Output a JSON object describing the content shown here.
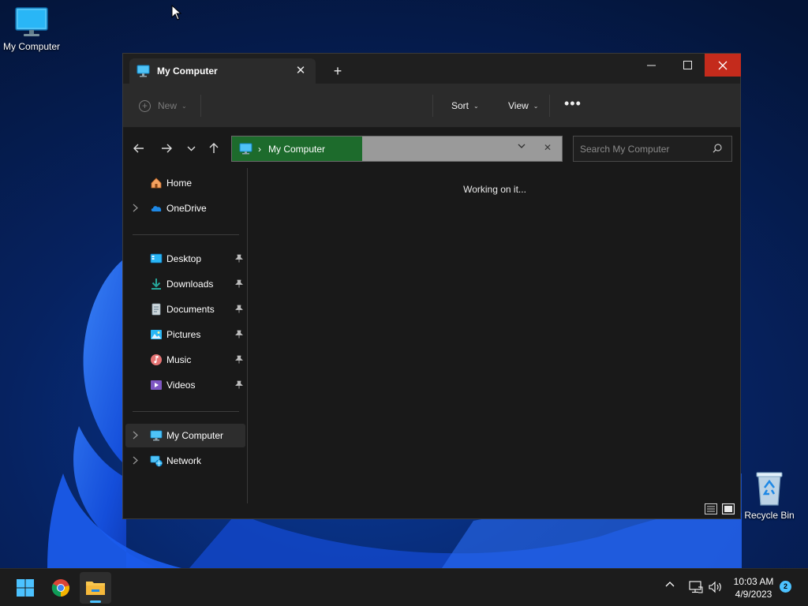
{
  "desktop": {
    "icons": [
      {
        "label": "My Computer",
        "icon": "monitor-icon"
      },
      {
        "label": "Recycle Bin",
        "icon": "recycle-bin-icon"
      }
    ]
  },
  "window": {
    "tab_title": "My Computer",
    "tab_icon": "monitor-icon",
    "controls": {
      "minimize": "minimize-icon",
      "maximize": "maximize-icon",
      "close": "close-icon"
    },
    "close_color": "#c42b1c"
  },
  "commandbar": {
    "new_label": "New",
    "sort_label": "Sort",
    "view_label": "View",
    "more_label": "•••"
  },
  "navigation": {
    "back_icon": "arrow-left-icon",
    "forward_icon": "arrow-right-icon",
    "recent_icon": "chevron-down-icon",
    "up_icon": "arrow-up-icon"
  },
  "address": {
    "separator": "›",
    "crumb": "My Computer",
    "crumb_bg": "#1d6b2c",
    "clear": "✕"
  },
  "search": {
    "placeholder": "Search My Computer"
  },
  "sidebar": {
    "items": [
      {
        "label": "Home",
        "icon": "home-icon",
        "expandable": false,
        "pinned": false
      },
      {
        "label": "OneDrive",
        "icon": "cloud-icon",
        "expandable": true,
        "pinned": false
      },
      {
        "label": "Desktop",
        "icon": "desktop-folder-icon",
        "expandable": false,
        "pinned": true
      },
      {
        "label": "Downloads",
        "icon": "download-icon",
        "expandable": false,
        "pinned": true
      },
      {
        "label": "Documents",
        "icon": "document-icon",
        "expandable": false,
        "pinned": true
      },
      {
        "label": "Pictures",
        "icon": "pictures-icon",
        "expandable": false,
        "pinned": true
      },
      {
        "label": "Music",
        "icon": "music-icon",
        "expandable": false,
        "pinned": true
      },
      {
        "label": "Videos",
        "icon": "videos-icon",
        "expandable": false,
        "pinned": true
      },
      {
        "label": "My Computer",
        "icon": "monitor-icon",
        "expandable": true,
        "pinned": false,
        "selected": true
      },
      {
        "label": "Network",
        "icon": "network-icon",
        "expandable": true,
        "pinned": false
      }
    ]
  },
  "content": {
    "status": "Working on it..."
  },
  "statusbar": {
    "details_view_icon": "details-view-icon",
    "tiles_view_icon": "tiles-view-icon"
  },
  "taskbar": {
    "apps": [
      {
        "name": "Start",
        "icon": "windows-start-icon"
      },
      {
        "name": "Google Chrome",
        "icon": "chrome-icon"
      },
      {
        "name": "File Explorer",
        "icon": "folder-icon",
        "active": true
      }
    ],
    "time": "10:03 AM",
    "date": "4/9/2023",
    "notification_count": "2",
    "accent": "#4cc2ff"
  }
}
